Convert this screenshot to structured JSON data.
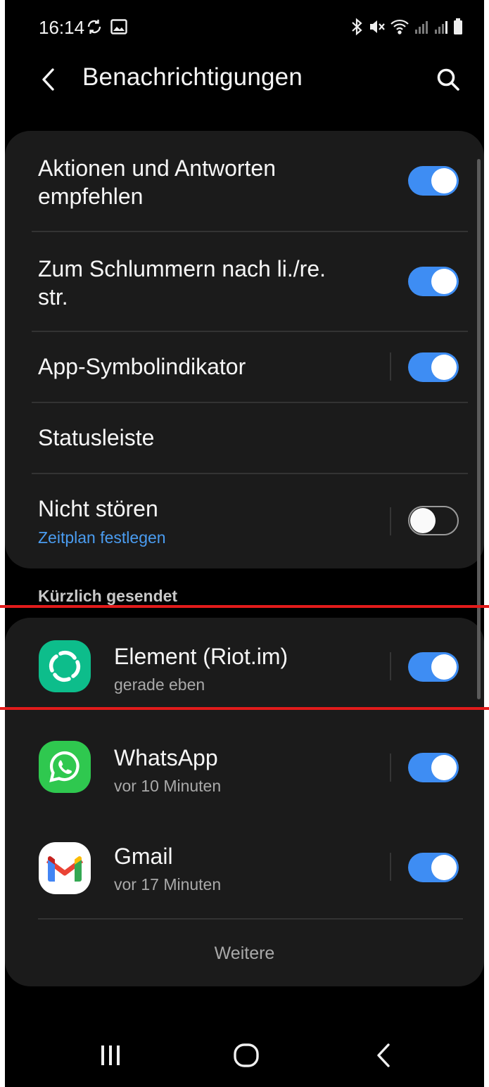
{
  "status_bar": {
    "time": "16:14",
    "left_icons": [
      "sync-icon",
      "image-icon"
    ],
    "right_icons": [
      "bluetooth-icon",
      "mute-icon",
      "wifi-icon",
      "signal-icon",
      "signal-icon",
      "battery-icon"
    ]
  },
  "header": {
    "title": "Benachrichtigungen",
    "back_icon": "chevron-left-icon",
    "search_icon": "search-icon"
  },
  "settings": [
    {
      "title_line1": "Aktionen und Antworten",
      "title_line2": "empfehlen",
      "enabled": true
    },
    {
      "title_line1": "Zum Schlummern nach li./re.",
      "title_line2": "str.",
      "enabled": true
    },
    {
      "title": "App-Symbolindikator",
      "enabled": true
    },
    {
      "title": "Statusleiste"
    },
    {
      "title": "Nicht stören",
      "subtitle": "Zeitplan festlegen",
      "enabled": false
    }
  ],
  "recent": {
    "section_label": "Kürzlich gesendet",
    "apps": [
      {
        "name": "Element (Riot.im)",
        "time": "gerade eben",
        "icon": "element-icon",
        "enabled": true
      },
      {
        "name": "WhatsApp",
        "time": "vor 10 Minuten",
        "icon": "whatsapp-icon",
        "enabled": true
      },
      {
        "name": "Gmail",
        "time": "vor 17 Minuten",
        "icon": "gmail-icon",
        "enabled": true
      }
    ],
    "more_label": "Weitere"
  },
  "nav_bar": [
    "recent-apps-icon",
    "home-icon",
    "back-icon"
  ],
  "colors": {
    "background": "#000000",
    "card": "#1b1b1b",
    "accent": "#3e8df3",
    "link": "#4a9cf0",
    "annotation_line": "#e21b1b"
  }
}
